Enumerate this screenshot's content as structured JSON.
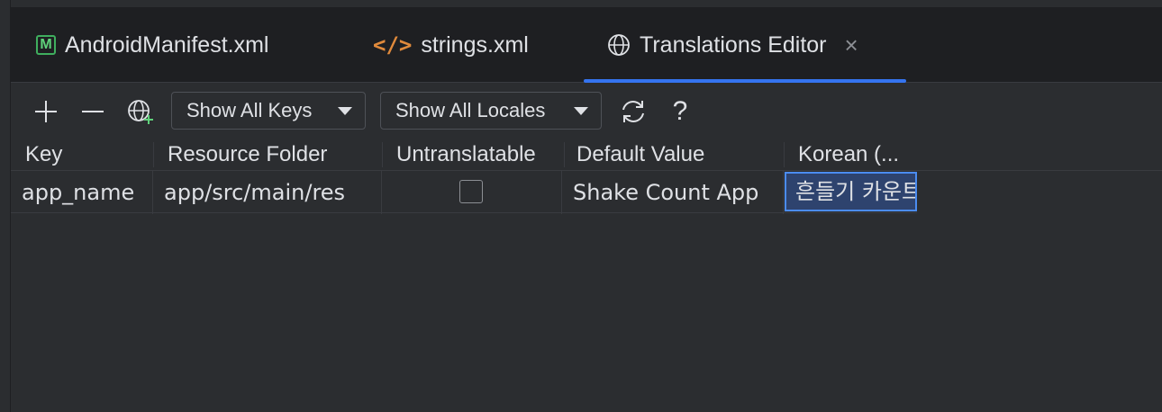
{
  "tabs": [
    {
      "label": "AndroidManifest.xml",
      "icon": "manifest-file-icon",
      "icon_text": "M",
      "active": false
    },
    {
      "label": "strings.xml",
      "icon": "xml-code-icon",
      "icon_text": "</>",
      "active": false
    },
    {
      "label": "Translations Editor",
      "icon": "globe-icon",
      "active": true,
      "close_glyph": "×"
    }
  ],
  "toolbar": {
    "add_glyph": "+",
    "remove_glyph": "—",
    "keys_filter": "Show All Keys",
    "locales_filter": "Show All Locales",
    "help_glyph": "?"
  },
  "columns": [
    "Key",
    "Resource Folder",
    "Untranslatable",
    "Default Value",
    "Korean (..."
  ],
  "rows": [
    {
      "key": "app_name",
      "resource_folder": "app/src/main/res",
      "untranslatable": false,
      "default_value": "Shake Count App",
      "korean": "흔들기 카운트"
    }
  ],
  "colors": {
    "accent": "#3574f0",
    "background": "#2b2d30",
    "tabbar": "#1e1f22",
    "selection": "#2e436e"
  }
}
